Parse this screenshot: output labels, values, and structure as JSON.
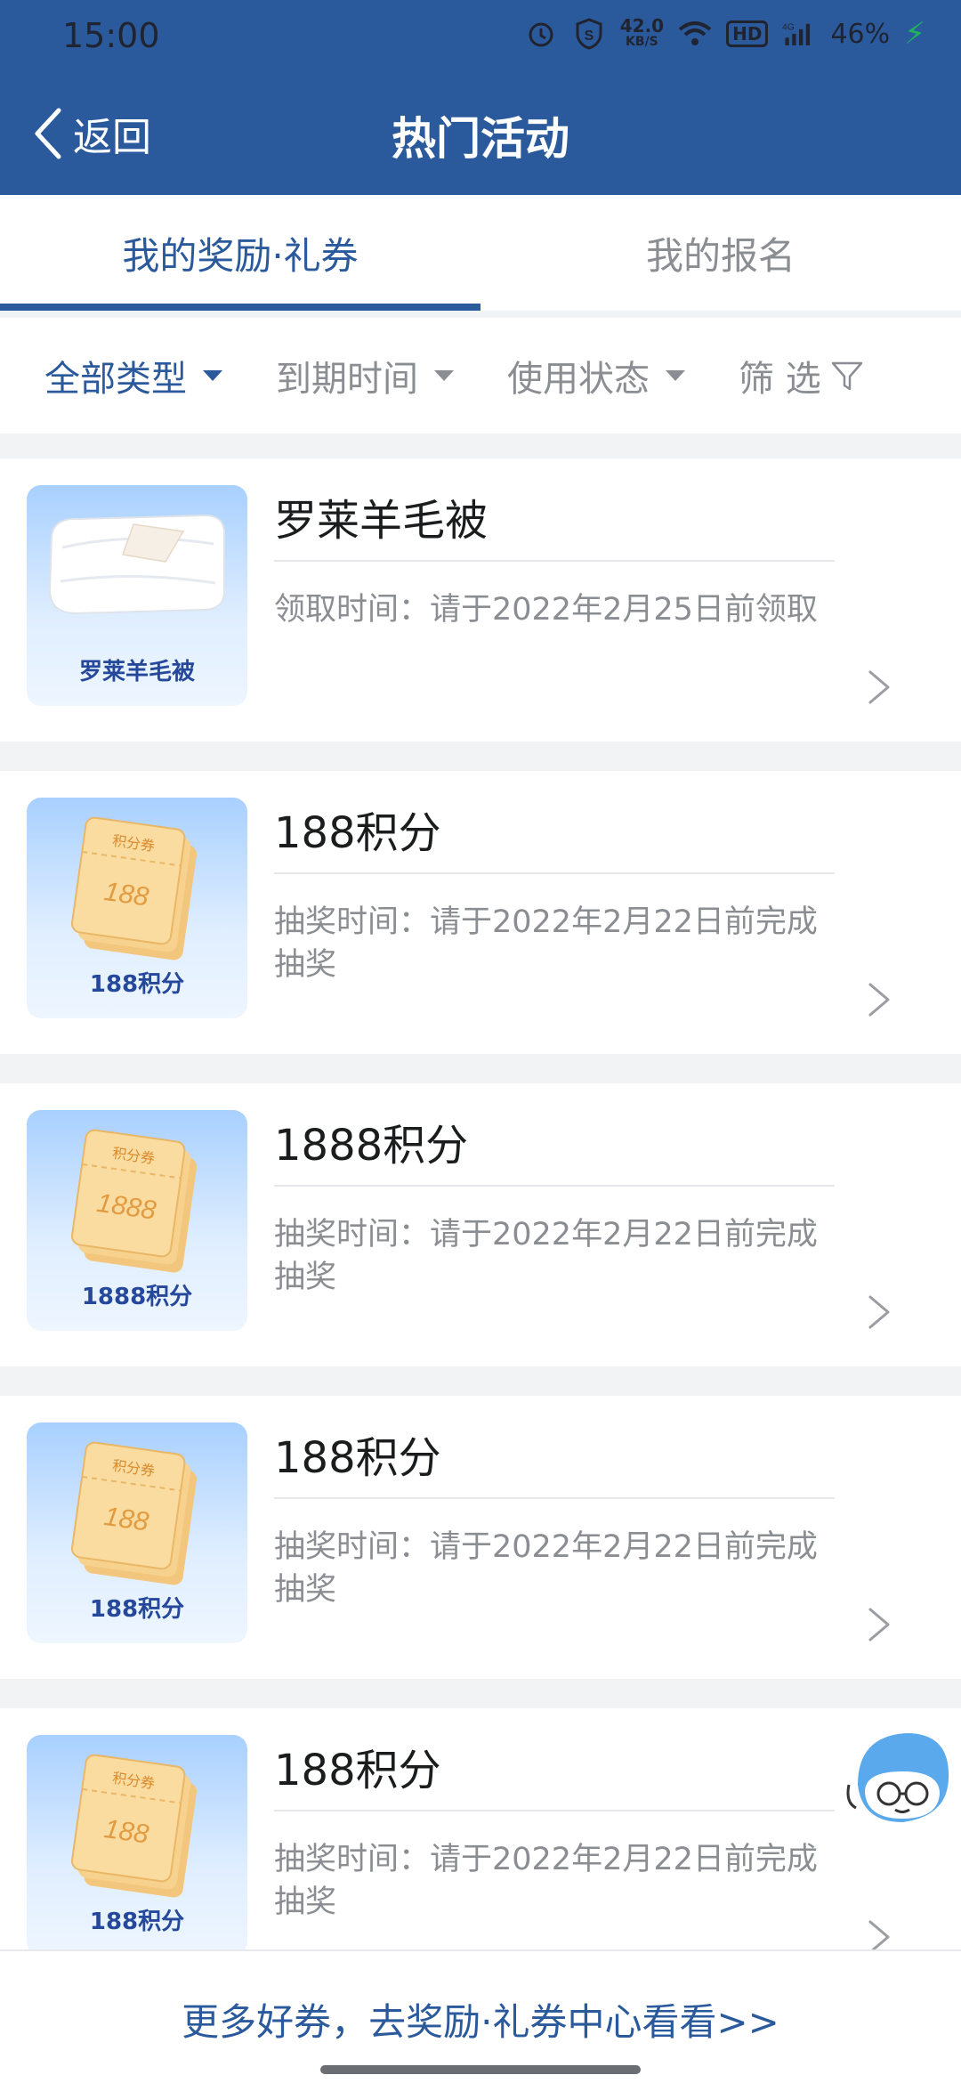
{
  "status_bar": {
    "time": "15:00",
    "net_speed_value": "42.0",
    "net_speed_unit": "KB/S",
    "hd": "HD",
    "signal": "4G",
    "battery": "46%"
  },
  "header": {
    "back_label": "返回",
    "title": "热门活动"
  },
  "tabs": [
    {
      "label": "我的奖励·礼券",
      "active": true
    },
    {
      "label": "我的报名",
      "active": false
    }
  ],
  "filters": [
    {
      "label": "全部类型"
    },
    {
      "label": "到期时间"
    },
    {
      "label": "使用状态"
    },
    {
      "label": "筛 选"
    }
  ],
  "items": [
    {
      "title": "罗莱羊毛被",
      "desc": "领取时间：请于2022年2月25日前领取",
      "thumb_label": "罗莱羊毛被",
      "thumb_type": "quilt"
    },
    {
      "title": "188积分",
      "desc": "抽奖时间：请于2022年2月22日前完成抽奖",
      "thumb_label": "188积分",
      "thumb_type": "points",
      "points": "188"
    },
    {
      "title": "1888积分",
      "desc": "抽奖时间：请于2022年2月22日前完成抽奖",
      "thumb_label": "1888积分",
      "thumb_type": "points",
      "points": "1888"
    },
    {
      "title": "188积分",
      "desc": "抽奖时间：请于2022年2月22日前完成抽奖",
      "thumb_label": "188积分",
      "thumb_type": "points",
      "points": "188"
    },
    {
      "title": "188积分",
      "desc": "抽奖时间：请于2022年2月22日前完成抽奖",
      "thumb_label": "188积分",
      "thumb_type": "points",
      "points": "188"
    }
  ],
  "coupon_badge": "积分券",
  "footer": {
    "link_text": "更多好券，去奖励·礼券中心看看>>"
  },
  "colors": {
    "brand": "#2b5a9c",
    "muted": "#8a8d92",
    "background": "#f2f3f5"
  }
}
